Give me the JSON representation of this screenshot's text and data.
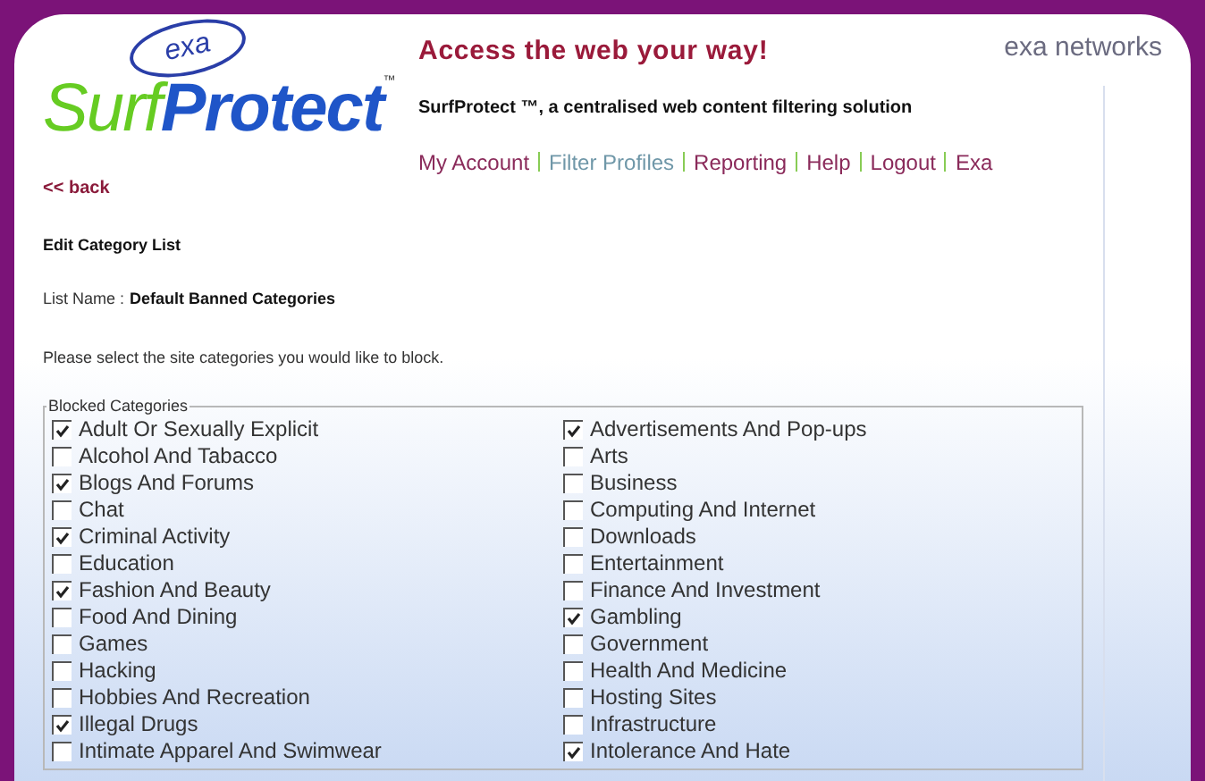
{
  "logo": {
    "badge": "exa",
    "word_1": "Surf",
    "word_2": "Protect",
    "trademark": "™"
  },
  "partner_logo": "exa networks",
  "tagline": "Access the web your way!",
  "subtitle": "SurfProtect ™, a centralised web content filtering solution",
  "nav": [
    {
      "label": "My Account",
      "selected": false
    },
    {
      "label": "Filter Profiles",
      "selected": true
    },
    {
      "label": "Reporting",
      "selected": false
    },
    {
      "label": "Help",
      "selected": false
    },
    {
      "label": "Logout",
      "selected": false
    },
    {
      "label": "Exa",
      "selected": false
    }
  ],
  "back_link": "<< back",
  "heading": "Edit Category List",
  "list_name": {
    "label": "List Name :",
    "value": "Default Banned Categories"
  },
  "instructions": "Please select the site categories you would like to block.",
  "fieldset": {
    "legend": "Blocked Categories",
    "categories": [
      {
        "label": "Adult Or Sexually Explicit",
        "checked": true
      },
      {
        "label": "Advertisements And Pop-ups",
        "checked": true
      },
      {
        "label": "Alcohol And Tabacco",
        "checked": false
      },
      {
        "label": "Arts",
        "checked": false
      },
      {
        "label": "Blogs And Forums",
        "checked": true
      },
      {
        "label": "Business",
        "checked": false
      },
      {
        "label": "Chat",
        "checked": false
      },
      {
        "label": "Computing And Internet",
        "checked": false
      },
      {
        "label": "Criminal Activity",
        "checked": true
      },
      {
        "label": "Downloads",
        "checked": false
      },
      {
        "label": "Education",
        "checked": false
      },
      {
        "label": "Entertainment",
        "checked": false
      },
      {
        "label": "Fashion And Beauty",
        "checked": true
      },
      {
        "label": "Finance And Investment",
        "checked": false
      },
      {
        "label": "Food And Dining",
        "checked": false
      },
      {
        "label": "Gambling",
        "checked": true
      },
      {
        "label": "Games",
        "checked": false
      },
      {
        "label": "Government",
        "checked": false
      },
      {
        "label": "Hacking",
        "checked": false
      },
      {
        "label": "Health And Medicine",
        "checked": false
      },
      {
        "label": "Hobbies And Recreation",
        "checked": false
      },
      {
        "label": "Hosting Sites",
        "checked": false
      },
      {
        "label": "Illegal Drugs",
        "checked": true
      },
      {
        "label": "Infrastructure",
        "checked": false
      },
      {
        "label": "Intimate Apparel And Swimwear",
        "checked": false
      },
      {
        "label": "Intolerance And Hate",
        "checked": true
      }
    ]
  }
}
